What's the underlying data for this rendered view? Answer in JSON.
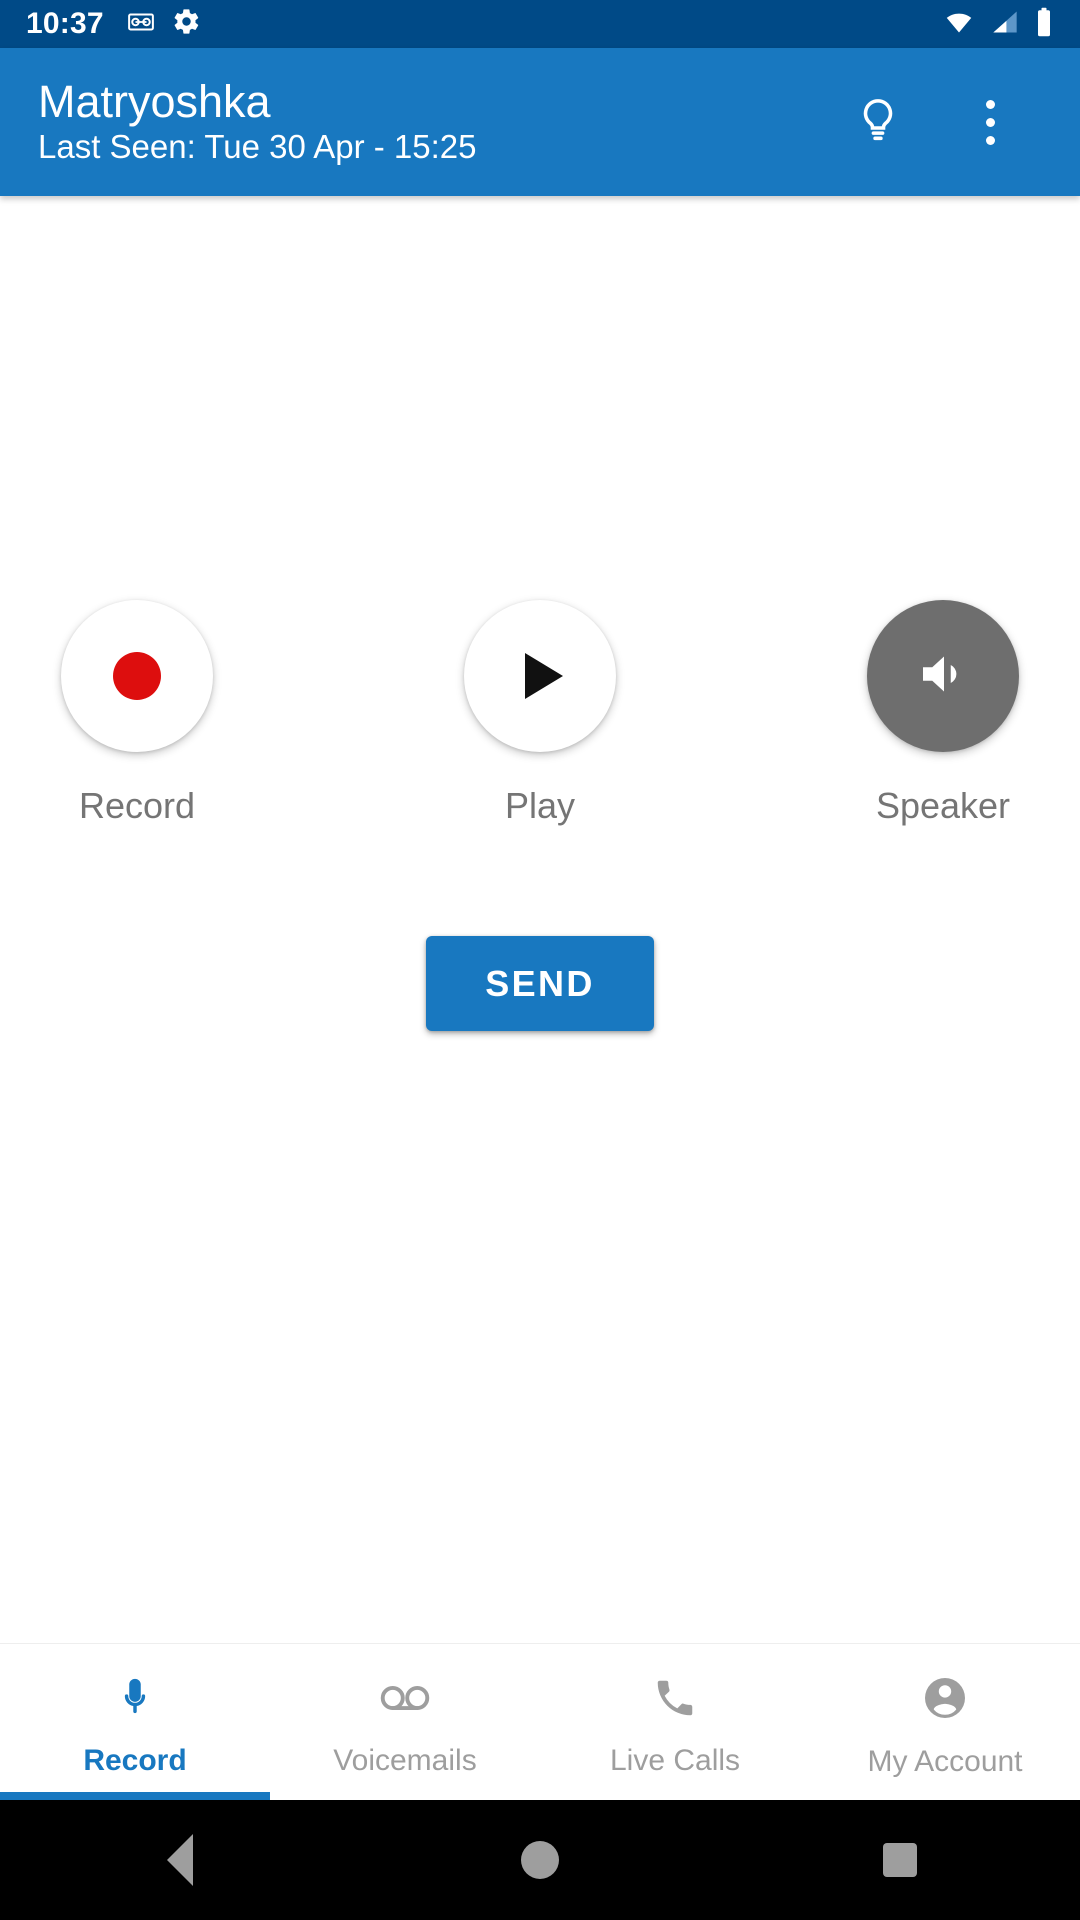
{
  "status_bar": {
    "clock": "10:37",
    "left_icons": [
      "voicemail-icon",
      "gear-icon"
    ],
    "right_icons": [
      "wifi-icon",
      "cellular-signal-icon",
      "battery-icon"
    ],
    "background_color": "#004A87"
  },
  "app_bar": {
    "title": "Matryoshka",
    "subtitle": "Last Seen: Tue 30 Apr - 15:25",
    "background_color": "#1878C0",
    "actions": [
      {
        "name": "lightbulb-icon",
        "label": "Tips"
      },
      {
        "name": "overflow-menu-icon",
        "label": "More options"
      }
    ]
  },
  "main": {
    "controls": [
      {
        "label": "Record",
        "icon": "record-dot-icon",
        "state": "inactive",
        "accent": "#DD0E0E"
      },
      {
        "label": "Play",
        "icon": "play-triangle-icon",
        "state": "inactive",
        "accent": "#111111"
      },
      {
        "label": "Speaker",
        "icon": "speaker-icon",
        "state": "active",
        "accent": "#6E6E6E"
      }
    ],
    "send_label": "SEND"
  },
  "bottom_nav": {
    "active_index": 0,
    "items": [
      {
        "label": "Record",
        "icon": "microphone-icon"
      },
      {
        "label": "Voicemails",
        "icon": "voicemail-icon"
      },
      {
        "label": "Live Calls",
        "icon": "phone-icon"
      },
      {
        "label": "My Account",
        "icon": "account-circle-icon"
      }
    ],
    "active_color": "#1878C0",
    "inactive_color": "#9E9E9E"
  },
  "system_nav": {
    "buttons": [
      {
        "name": "back-button",
        "label": "Back"
      },
      {
        "name": "home-button",
        "label": "Home"
      },
      {
        "name": "recents-button",
        "label": "Recents"
      }
    ]
  }
}
